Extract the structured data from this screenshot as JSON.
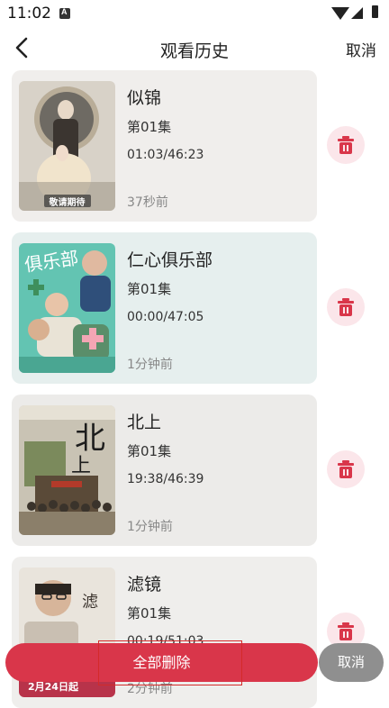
{
  "status_bar": {
    "time": "11:02"
  },
  "header": {
    "title": "观看历史",
    "cancel_label": "取消"
  },
  "history": [
    {
      "title": "似锦",
      "episode": "第01集",
      "progress": "01:03/46:23",
      "watched_ago": "37秒前",
      "poster_badge": "敬请期待",
      "card_color": "#f0eeec"
    },
    {
      "title": "仁心俱乐部",
      "episode": "第01集",
      "progress": "00:00/47:05",
      "watched_ago": "1分钟前",
      "card_color": "#e6efee"
    },
    {
      "title": "北上",
      "episode": "第01集",
      "progress": "19:38/46:39",
      "watched_ago": "1分钟前",
      "card_color": "#ecebe9"
    },
    {
      "title": "滤镜",
      "episode": "第01集",
      "progress": "00:19/51:03",
      "watched_ago": "2分钟前",
      "card_color": "#efeeec"
    }
  ],
  "footer": {
    "delete_all_label": "全部删除",
    "cancel_label": "取消"
  },
  "colors": {
    "accent": "#d9364a",
    "trash_bg": "#fbe6ea",
    "cancel_bg": "#8f8f8f"
  }
}
